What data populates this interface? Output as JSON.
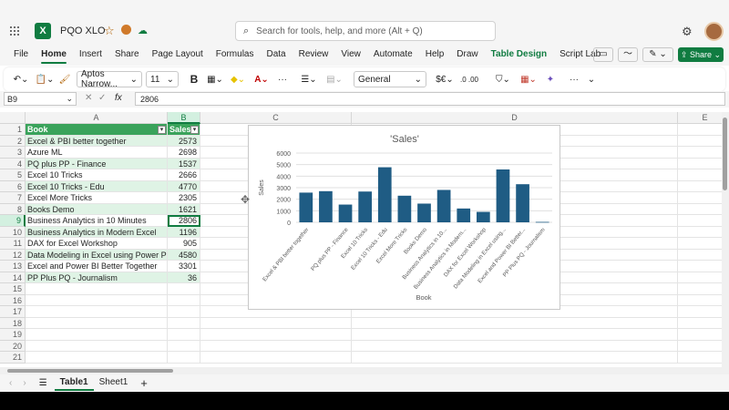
{
  "app": {
    "title": "PQO XLO",
    "search_placeholder": "Search for tools, help, and more (Alt + Q)"
  },
  "tabs": [
    "File",
    "Home",
    "Insert",
    "Share",
    "Page Layout",
    "Formulas",
    "Data",
    "Review",
    "View",
    "Automate",
    "Help",
    "Draw",
    "Table Design",
    "Script Lab"
  ],
  "share_label": "Share",
  "ribbon": {
    "font_name": "Aptos Narrow...",
    "font_size": "11",
    "number_format": "General",
    "bold": "B"
  },
  "formula_bar": {
    "name_box": "B9",
    "fx": "fx",
    "value": "2806"
  },
  "columns": [
    "A",
    "B",
    "C",
    "D",
    "E"
  ],
  "rows": [
    "1",
    "2",
    "3",
    "4",
    "5",
    "6",
    "7",
    "8",
    "9",
    "10",
    "11",
    "12",
    "13",
    "14",
    "15",
    "16",
    "17",
    "18",
    "19",
    "20",
    "21"
  ],
  "table": {
    "header": [
      "Book",
      "Sales"
    ],
    "rows": [
      [
        "Excel & PBI better together",
        "2573"
      ],
      [
        "Azure ML",
        "2698"
      ],
      [
        "PQ plus PP - Finance",
        "1537"
      ],
      [
        "Excel 10 Tricks",
        "2666"
      ],
      [
        "Excel 10 Tricks - Edu",
        "4770"
      ],
      [
        "Excel More Tricks",
        "2305"
      ],
      [
        "Books Demo",
        "1621"
      ],
      [
        "Business Analytics in 10 Minutes",
        "2806"
      ],
      [
        "Business Analytics in Modern Excel",
        "1196"
      ],
      [
        "DAX for Excel Workshop",
        "905"
      ],
      [
        "Data Modeling in Excel using Power Pivot",
        "4580"
      ],
      [
        "Excel and Power BI Better Together",
        "3301"
      ],
      [
        "PP Plus PQ - Journalism",
        "36"
      ]
    ]
  },
  "chart_data": {
    "type": "bar",
    "title": "'Sales'",
    "xlabel": "Book",
    "ylabel": "Sales",
    "ylim": [
      0,
      6000
    ],
    "yticks": [
      "0",
      "1000",
      "2000",
      "3000",
      "4000",
      "5000",
      "6000"
    ],
    "categories": [
      "Excel & PBI better together",
      "Azure ML",
      "PQ plus PP - Finance",
      "Excel 10 Tricks",
      "Excel 10 Tricks - Edu",
      "Excel More Tricks",
      "Books Demo",
      "Business Analytics in 10...",
      "Business Analytics in Modern...",
      "DAX for Excel Workshop",
      "Data Modeling in Excel using...",
      "Excel and Power BI Better...",
      "PP Plus PQ - Journalism"
    ],
    "tick_labels": [
      "Excel & PBI better together",
      "PQ plus PP - Finance",
      "Excel 10 Tricks",
      "Excel 10 Tricks - Edu",
      "Excel More Tricks",
      "Books Demo",
      "Business Analytics in 10...",
      "Business Analytics in Modern...",
      "DAX for Excel Workshop",
      "Data Modeling in Excel using...",
      "Excel and Power BI Better...",
      "PP Plus PQ - Journalism"
    ],
    "values": [
      2573,
      2698,
      1537,
      2666,
      4770,
      2305,
      1621,
      2806,
      1196,
      905,
      4580,
      3301,
      36
    ],
    "bar_color": "#1f5c84",
    "grid": true
  },
  "sheets": [
    "Table1",
    "Sheet1"
  ],
  "colors": {
    "accent": "#107c41",
    "table_header": "#3aa35b",
    "band": "#dff3e5"
  }
}
